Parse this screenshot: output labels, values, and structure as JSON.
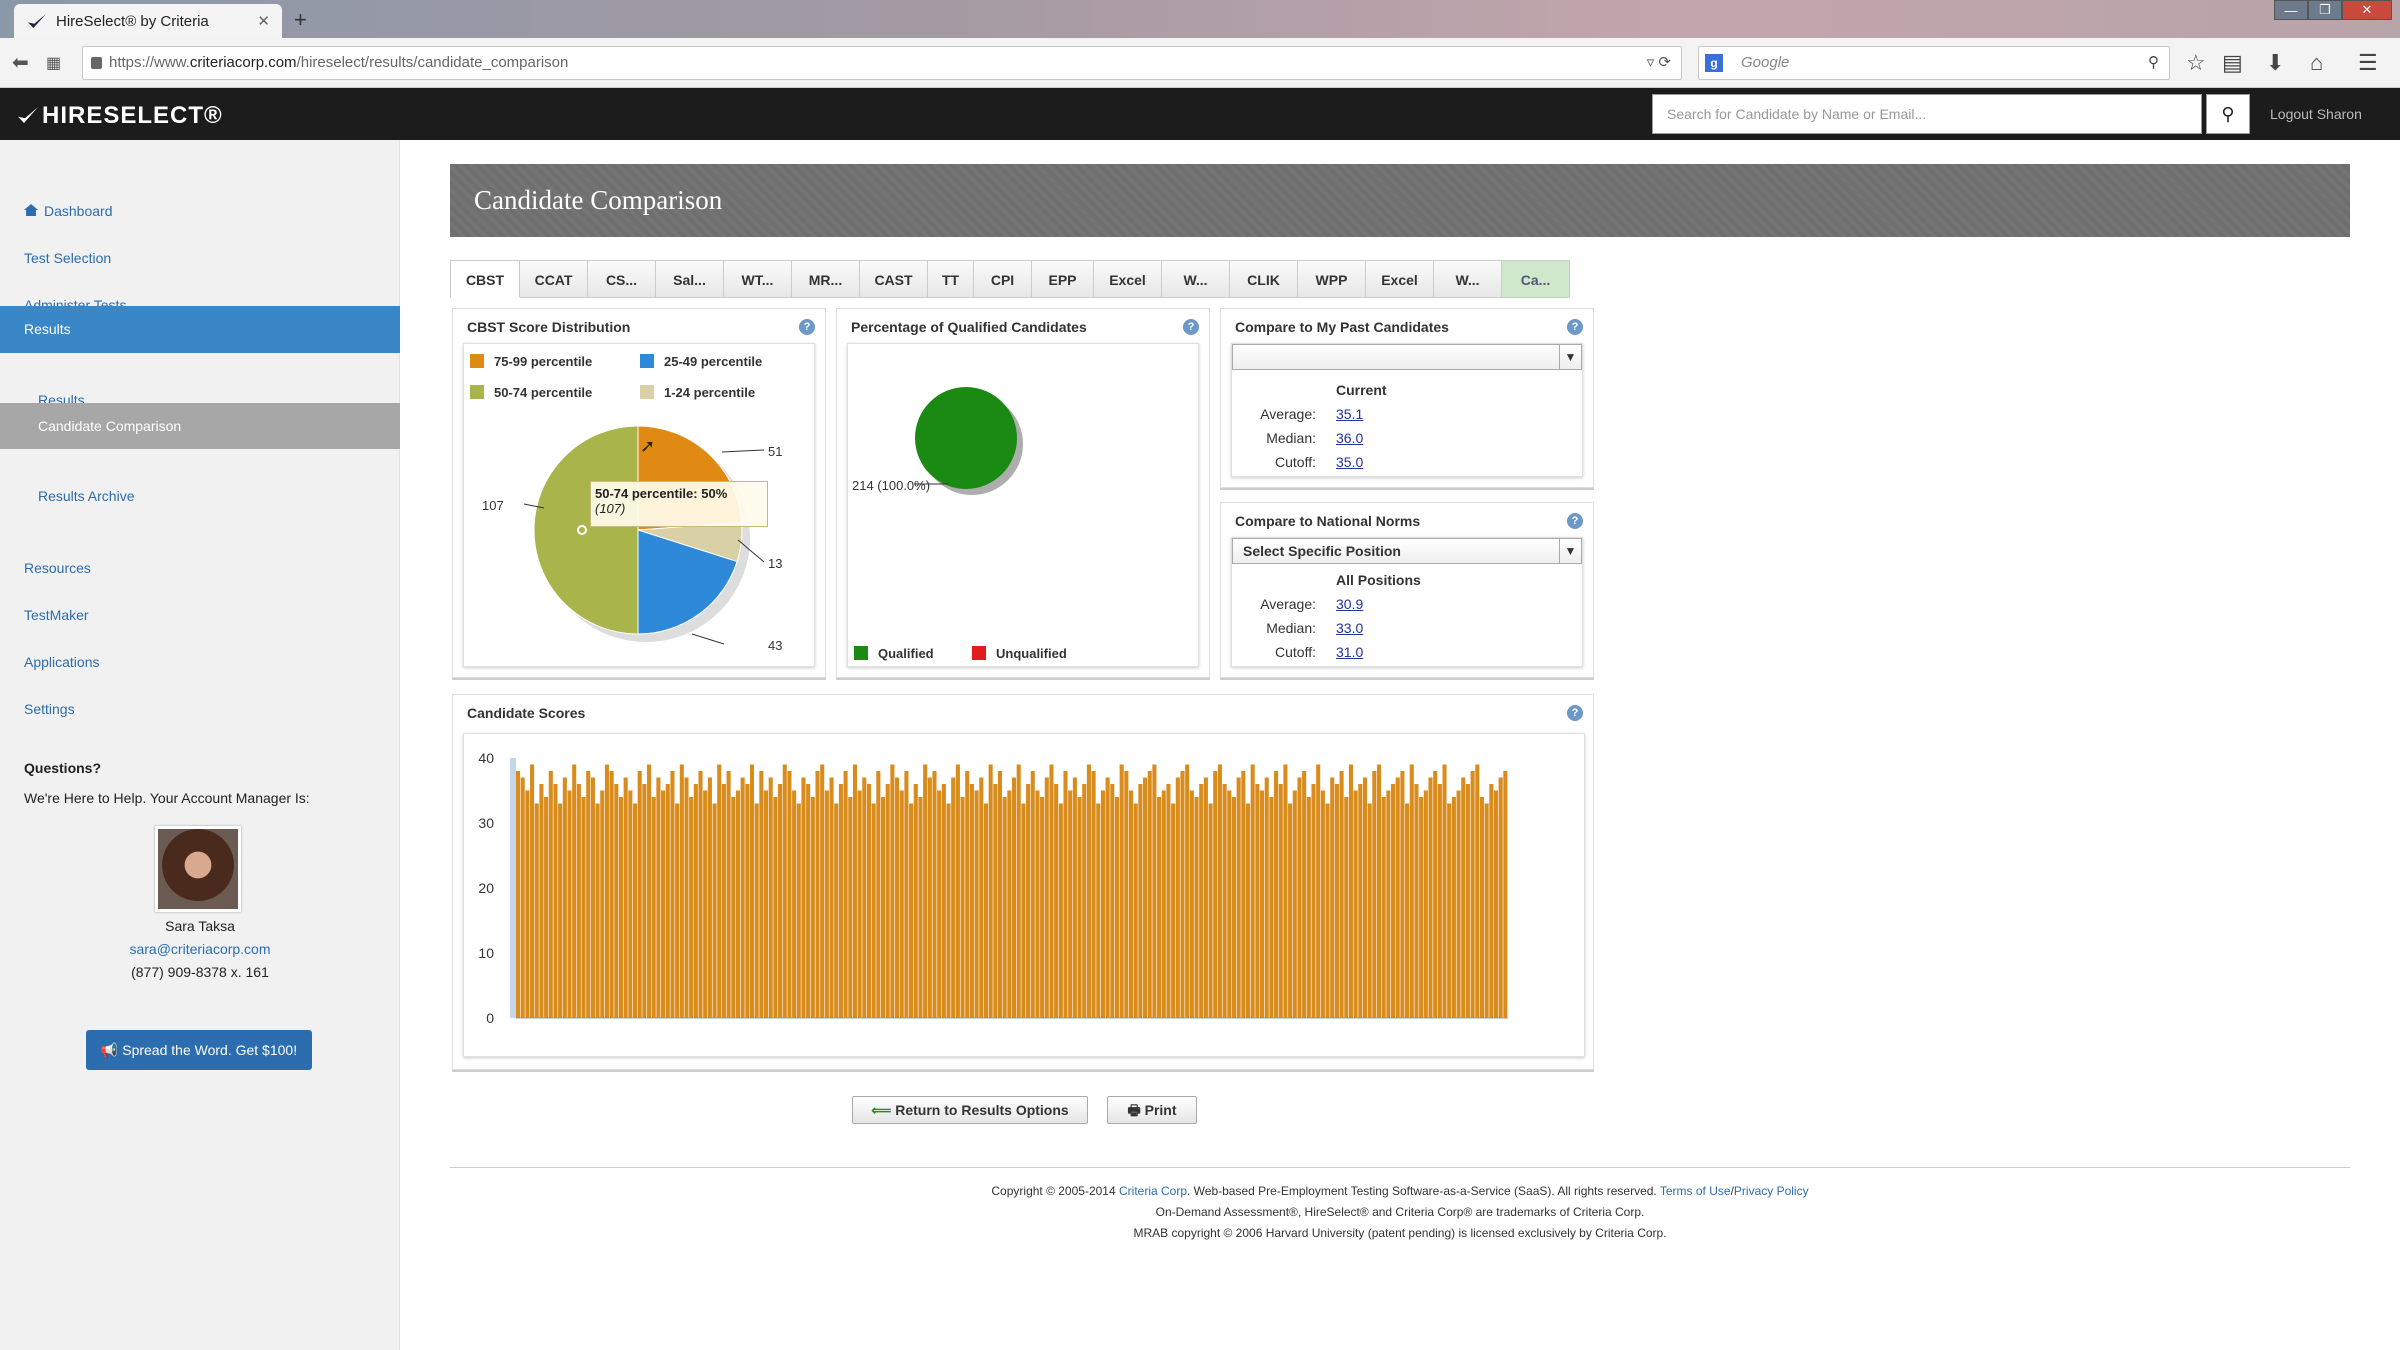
{
  "browser": {
    "tab_title": "HireSelect® by Criteria",
    "url_prefix": "https://www.",
    "url_domain": "criteriacorp.com",
    "url_path": "/hireselect/results/candidate_comparison",
    "search_placeholder": "Google",
    "new_tab": "+"
  },
  "header": {
    "logo": "HIRESELECT®",
    "search_placeholder": "Search for Candidate by Name or Email...",
    "logout": "Logout Sharon"
  },
  "sidebar": {
    "items": [
      {
        "label": "Dashboard"
      },
      {
        "label": "Test Selection"
      },
      {
        "label": "Administer Tests"
      },
      {
        "label": "Results"
      },
      {
        "label": "Results"
      },
      {
        "label": "Candidate Comparison"
      },
      {
        "label": "Results Archive"
      },
      {
        "label": "Resources"
      },
      {
        "label": "TestMaker"
      },
      {
        "label": "Applications"
      },
      {
        "label": "Settings"
      }
    ],
    "questions_heading": "Questions?",
    "questions_text": "We're Here to Help. Your Account Manager Is:",
    "manager_name": "Sara Taksa",
    "manager_email": "sara@criteriacorp.com",
    "manager_phone": "(877) 909-8378 x. 161",
    "spread_button": "Spread the Word. Get $100!"
  },
  "page": {
    "title": "Candidate Comparison",
    "tabs": [
      "CBST",
      "CCAT",
      "CS...",
      "Sal...",
      "WT...",
      "MR...",
      "CAST",
      "TT",
      "CPI",
      "EPP",
      "Excel",
      "W...",
      "CLIK",
      "WPP",
      "Excel",
      "W...",
      "Ca..."
    ]
  },
  "score_dist": {
    "title": "CBST Score Distribution",
    "legend": [
      {
        "label": "75-99 percentile",
        "color": "#e08a14"
      },
      {
        "label": "25-49 percentile",
        "color": "#2e8ad8"
      },
      {
        "label": "50-74 percentile",
        "color": "#a9b54a"
      },
      {
        "label": "1-24 percentile",
        "color": "#d9d0a6"
      }
    ],
    "labels": {
      "a": "51",
      "b": "13",
      "c": "43",
      "d": "107"
    },
    "tooltip_title": "50-74 percentile:",
    "tooltip_value": "50%",
    "tooltip_count": "(107)"
  },
  "qualified": {
    "title": "Percentage of Qualified Candidates",
    "label": "214 (100.0%)",
    "legend_q": "Qualified",
    "legend_u": "Unqualified",
    "q_color": "#1a8a12",
    "u_color": "#e31b1b"
  },
  "past": {
    "title": "Compare to My Past Candidates",
    "select_value": "",
    "head": "Current",
    "avg_label": "Average:",
    "avg": "35.1",
    "med_label": "Median:",
    "med": "36.0",
    "cut_label": "Cutoff:",
    "cut": "35.0"
  },
  "national": {
    "title": "Compare to National Norms",
    "select_value": "Select Specific Position",
    "head": "All Positions",
    "avg_label": "Average:",
    "avg": "30.9",
    "med_label": "Median:",
    "med": "33.0",
    "cut_label": "Cutoff:",
    "cut": "31.0"
  },
  "scores_panel": {
    "title": "Candidate Scores",
    "bar_color": "#d98b1c"
  },
  "chart_data": [
    {
      "type": "pie",
      "title": "CBST Score Distribution",
      "slices": [
        {
          "name": "75-99 percentile",
          "value": 51
        },
        {
          "name": "1-24 percentile",
          "value": 13
        },
        {
          "name": "25-49 percentile",
          "value": 43
        },
        {
          "name": "50-74 percentile",
          "value": 107
        }
      ]
    },
    {
      "type": "pie",
      "title": "Percentage of Qualified Candidates",
      "slices": [
        {
          "name": "Qualified",
          "value": 214
        },
        {
          "name": "Unqualified",
          "value": 0
        }
      ]
    },
    {
      "type": "bar",
      "title": "Candidate Scores",
      "ylim": [
        0,
        40
      ],
      "yticks": [
        0,
        10,
        20,
        30,
        40
      ],
      "values": [
        38,
        37,
        35,
        39,
        33,
        36,
        34,
        38,
        36,
        33,
        37,
        35,
        39,
        36,
        34,
        38,
        37,
        33,
        35,
        39,
        38,
        36,
        34,
        37,
        35,
        33,
        38,
        36,
        39,
        34,
        37,
        35,
        36,
        38,
        33,
        39,
        37,
        34,
        36,
        38,
        35,
        37,
        33,
        39,
        36,
        38,
        34,
        35,
        37,
        36,
        39,
        33,
        38,
        35,
        37,
        34,
        36,
        39,
        38,
        35,
        33,
        37,
        36,
        34,
        38,
        39,
        35,
        37,
        33,
        36,
        38,
        34,
        39,
        35,
        37,
        36,
        33,
        38,
        34,
        36,
        39,
        37,
        35,
        38,
        33,
        36,
        34,
        39,
        37,
        38,
        35,
        36,
        33,
        37,
        39,
        34,
        38,
        36,
        35,
        37,
        33,
        39,
        36,
        38,
        34,
        35,
        37,
        39,
        33,
        36,
        38,
        35,
        34,
        37,
        39,
        36,
        33,
        38,
        35,
        37,
        34,
        36,
        39,
        38,
        33,
        35,
        37,
        36,
        34,
        39,
        38,
        35,
        33,
        36,
        37,
        38,
        39,
        34,
        35,
        36,
        33,
        37,
        38,
        39,
        35,
        34,
        36,
        37,
        33,
        38,
        39,
        36,
        35,
        34,
        37,
        38,
        33,
        39,
        36,
        35,
        37,
        34,
        38,
        36,
        39,
        33,
        35,
        37,
        38,
        34,
        36,
        39,
        35,
        33,
        37,
        36,
        38,
        34,
        39,
        35,
        36,
        37,
        33,
        38,
        39,
        34,
        35,
        36,
        37,
        38,
        33,
        39,
        36,
        34,
        35,
        37,
        38,
        36,
        39,
        33,
        34,
        35,
        37,
        36,
        38,
        39,
        34,
        33,
        36,
        35,
        37,
        38
      ]
    }
  ],
  "buttons": {
    "return": "Return to Results Options",
    "print": "Print"
  },
  "footer": {
    "line1_a": "Copyright © 2005-2014 ",
    "line1_link": "Criteria Corp",
    "line1_b": ". Web-based Pre-Employment Testing Software-as-a-Service (SaaS). All rights reserved. ",
    "line1_terms": "Terms of Use",
    "line1_sep": "/",
    "line1_privacy": "Privacy Policy",
    "line2": "On-Demand Assessment®, HireSelect® and Criteria Corp® are trademarks of Criteria Corp.",
    "line3": "MRAB copyright © 2006 Harvard University (patent pending) is licensed exclusively by Criteria Corp."
  }
}
